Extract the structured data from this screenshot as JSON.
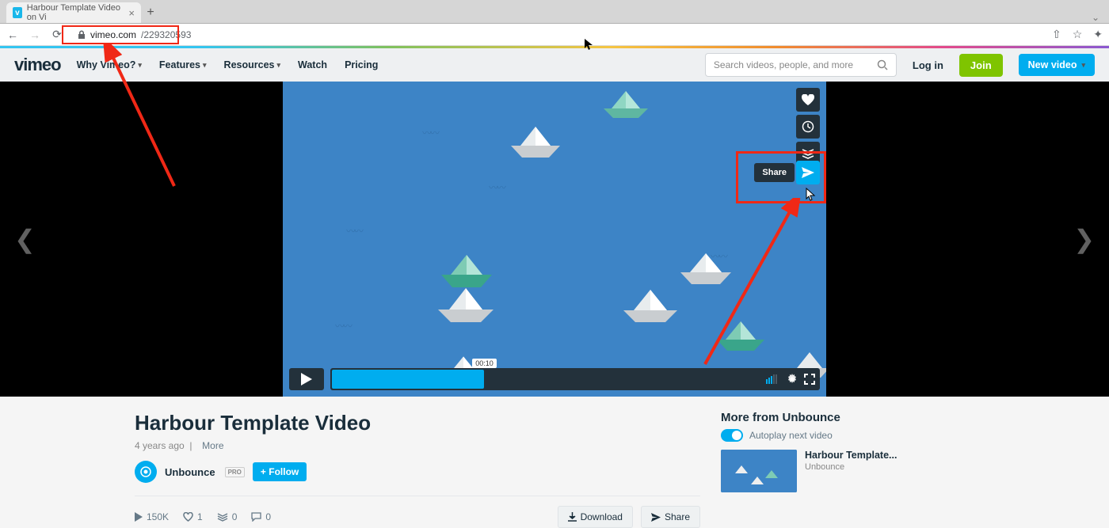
{
  "browser": {
    "tab_title": "Harbour Template Video on Vi",
    "url_host": "vimeo.com",
    "url_path": "/229320593"
  },
  "header": {
    "logo": "vimeo",
    "nav": [
      "Why Vimeo?",
      "Features",
      "Resources",
      "Watch",
      "Pricing"
    ],
    "search_placeholder": "Search videos, people, and more",
    "login": "Log in",
    "join": "Join",
    "new_video": "New video"
  },
  "player": {
    "share_label": "Share",
    "time": "00:10"
  },
  "video": {
    "title": "Harbour Template Video",
    "posted": "4 years ago",
    "more": "More",
    "uploader": "Unbounce",
    "uploader_badge": "PRO",
    "follow": "+ Follow",
    "plays": "150K",
    "likes": "1",
    "collections": "0",
    "comments": "0",
    "download": "Download",
    "share": "Share"
  },
  "sidebar": {
    "heading": "More from Unbounce",
    "autoplay": "Autoplay next video",
    "related_title": "Harbour Template...",
    "related_user": "Unbounce"
  }
}
